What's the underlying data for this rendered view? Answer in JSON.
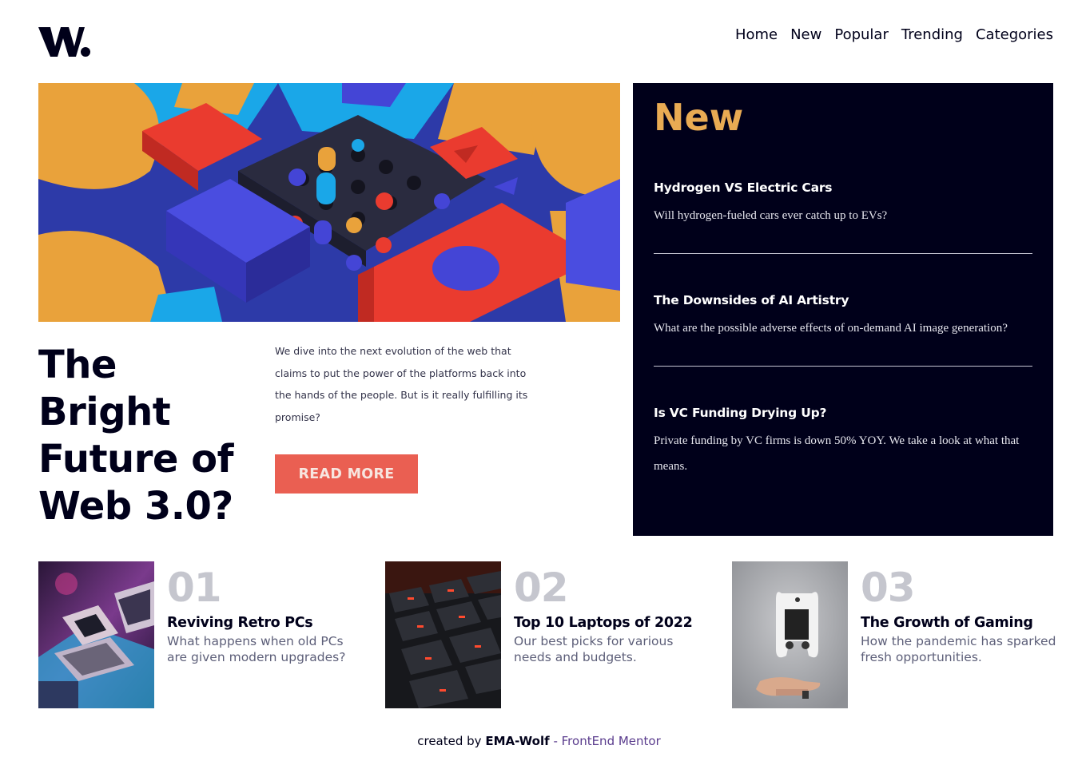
{
  "header": {
    "logo_text": "W.",
    "nav": [
      "Home",
      "New",
      "Popular",
      "Trending",
      "Categories"
    ]
  },
  "hero": {
    "title": "The Bright Future of Web 3.0?",
    "description": "We dive into the next evolution of the web that claims to put the power of the platforms back into the hands of the people. But is it really fulfilling its promise?",
    "button_label": "READ MORE"
  },
  "new_panel": {
    "heading": "New",
    "items": [
      {
        "title": "Hydrogen VS Electric Cars",
        "text": "Will hydrogen-fueled cars ever catch up to EVs?"
      },
      {
        "title": "The Downsides of AI Artistry",
        "text": "What are the possible adverse effects of on-demand AI image generation?"
      },
      {
        "title": "Is VC Funding Drying Up?",
        "text": "Private funding by VC firms is down 50% YOY. We take a look at what that means."
      }
    ]
  },
  "cards": [
    {
      "number": "01",
      "title": "Reviving Retro PCs",
      "text": "What happens when old PCs are given modern upgrades?"
    },
    {
      "number": "02",
      "title": "Top 10 Laptops of 2022",
      "text": "Our best picks for various needs and budgets."
    },
    {
      "number": "03",
      "title": "The Growth of Gaming",
      "text": "How the pandemic has sparked fresh opportunities."
    }
  ],
  "footer": {
    "prefix": "created by",
    "author": "EMA-Wolf",
    "separator": "-",
    "link": "FrontEnd Mentor"
  },
  "colors": {
    "navy": "#00001a",
    "accent_orange": "#e9ab53",
    "button_red": "#ea5f52",
    "number_gray": "#c5c6ce"
  }
}
